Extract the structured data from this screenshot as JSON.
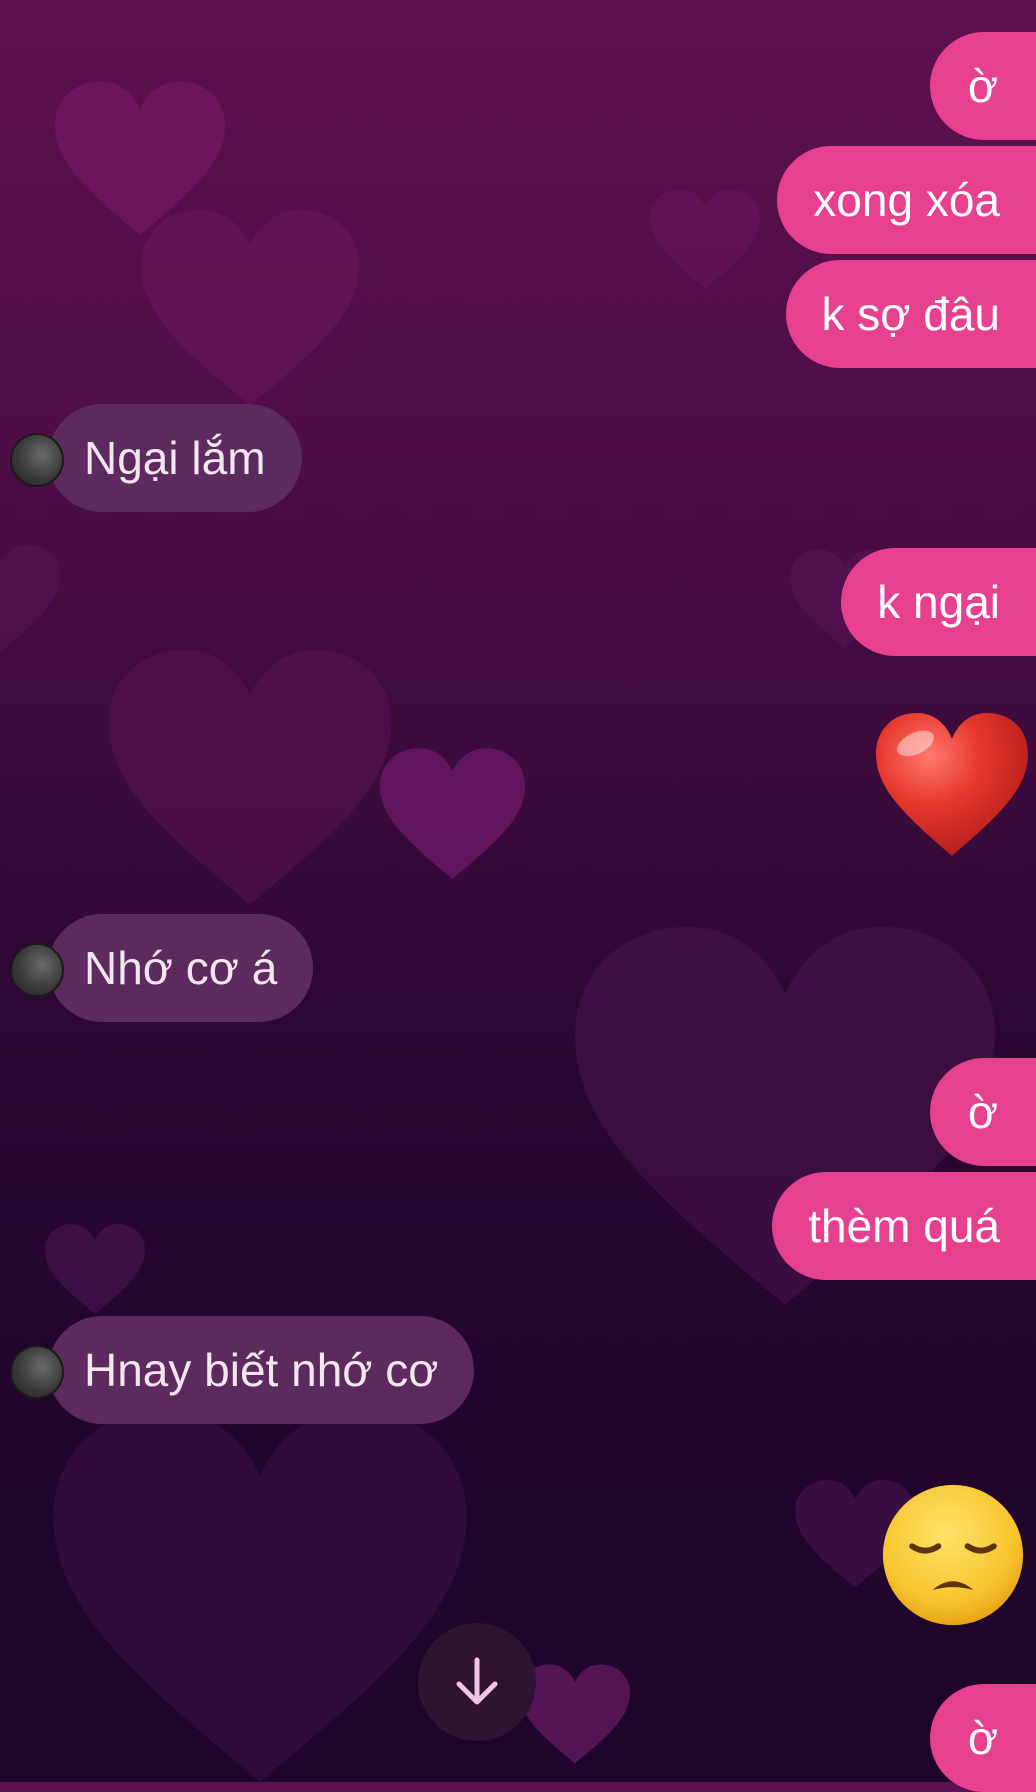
{
  "messages": [
    {
      "direction": "sent",
      "text": "ờ"
    },
    {
      "direction": "sent",
      "text": "xong xóa"
    },
    {
      "direction": "sent",
      "text": "k sợ đâu"
    },
    {
      "direction": "received",
      "text": "Ngại lắm"
    },
    {
      "direction": "sent",
      "text": "k ngại"
    },
    {
      "direction": "sent",
      "emoji": "heart-emoji"
    },
    {
      "direction": "received",
      "text": "Nhớ cơ á"
    },
    {
      "direction": "sent",
      "text": "ờ"
    },
    {
      "direction": "sent",
      "text": "thèm quá"
    },
    {
      "direction": "received",
      "text": "Hnay biết nhớ cơ"
    },
    {
      "direction": "sent",
      "emoji": "disappointed-face-emoji"
    },
    {
      "direction": "sent",
      "text": "ờ"
    }
  ],
  "icons": {
    "scroll_down": "arrow-down-icon"
  },
  "colors": {
    "sent_bubble": "#e6408f",
    "received_bubble": "#5c2a5c",
    "background_top": "#5e1150",
    "background_bottom": "#1f052b"
  }
}
